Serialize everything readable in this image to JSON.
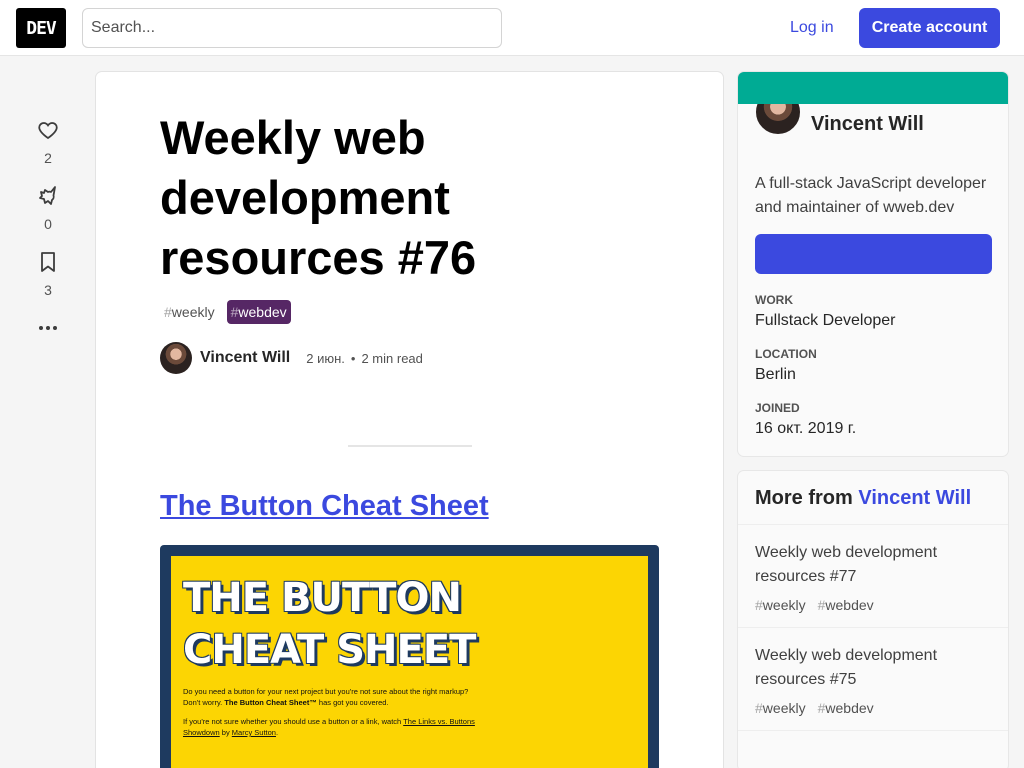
{
  "header": {
    "logo_text": "DEV",
    "search_placeholder": "Search...",
    "login_label": "Log in",
    "create_account_label": "Create account"
  },
  "reactions": {
    "likes": "2",
    "unicorns": "0",
    "saves": "3"
  },
  "article": {
    "title": "Weekly web development resources #76",
    "tags": [
      {
        "hash": "#",
        "name": "weekly"
      },
      {
        "hash": "#",
        "name": "webdev"
      }
    ],
    "author_name": "Vincent Will",
    "date": "2 июн.",
    "dot": "•",
    "read_time": "2 min read",
    "section_title": "The Button Cheat Sheet",
    "cover": {
      "title_line1": "THE BUTTON",
      "title_line2": "CHEAT SHEET",
      "text_line1": "Do you need a button for your next project but you're not sure about the right markup?",
      "text_line2_pre": "Don't worry. ",
      "text_line2_bold": "The Button Cheat Sheet™",
      "text_line2_post": " has got you covered.",
      "text_line3_pre": "If you're not sure whether you should use a button or a link, watch ",
      "text_line3_link": "The Links vs. Buttons",
      "text_line4_link": "Showdown",
      "text_line4_mid": " by ",
      "text_line4_author": "Marcy Sutton",
      "text_line4_end": "."
    }
  },
  "author_card": {
    "name": "Vincent Will",
    "bio": "A full-stack JavaScript developer and maintainer of wweb.dev",
    "work_label": "Work",
    "work_value": "Fullstack Developer",
    "location_label": "Location",
    "location_value": "Berlin",
    "joined_label": "Joined",
    "joined_value": "16 окт. 2019 г.",
    "banner_color": "#00ab94"
  },
  "more_from": {
    "prefix": "More from ",
    "author": "Vincent Will",
    "items": [
      {
        "title": "Weekly web development resources #77",
        "tag1_hash": "#",
        "tag1": "weekly",
        "tag2_hash": "#",
        "tag2": "webdev"
      },
      {
        "title": "Weekly web development resources #75",
        "tag1_hash": "#",
        "tag1": "weekly",
        "tag2_hash": "#",
        "tag2": "webdev"
      }
    ]
  },
  "colors": {
    "accent": "#3b49df",
    "webdev_tag": "#562765",
    "cover_yellow": "#fcd503",
    "cover_navy": "#1e3a5f"
  }
}
